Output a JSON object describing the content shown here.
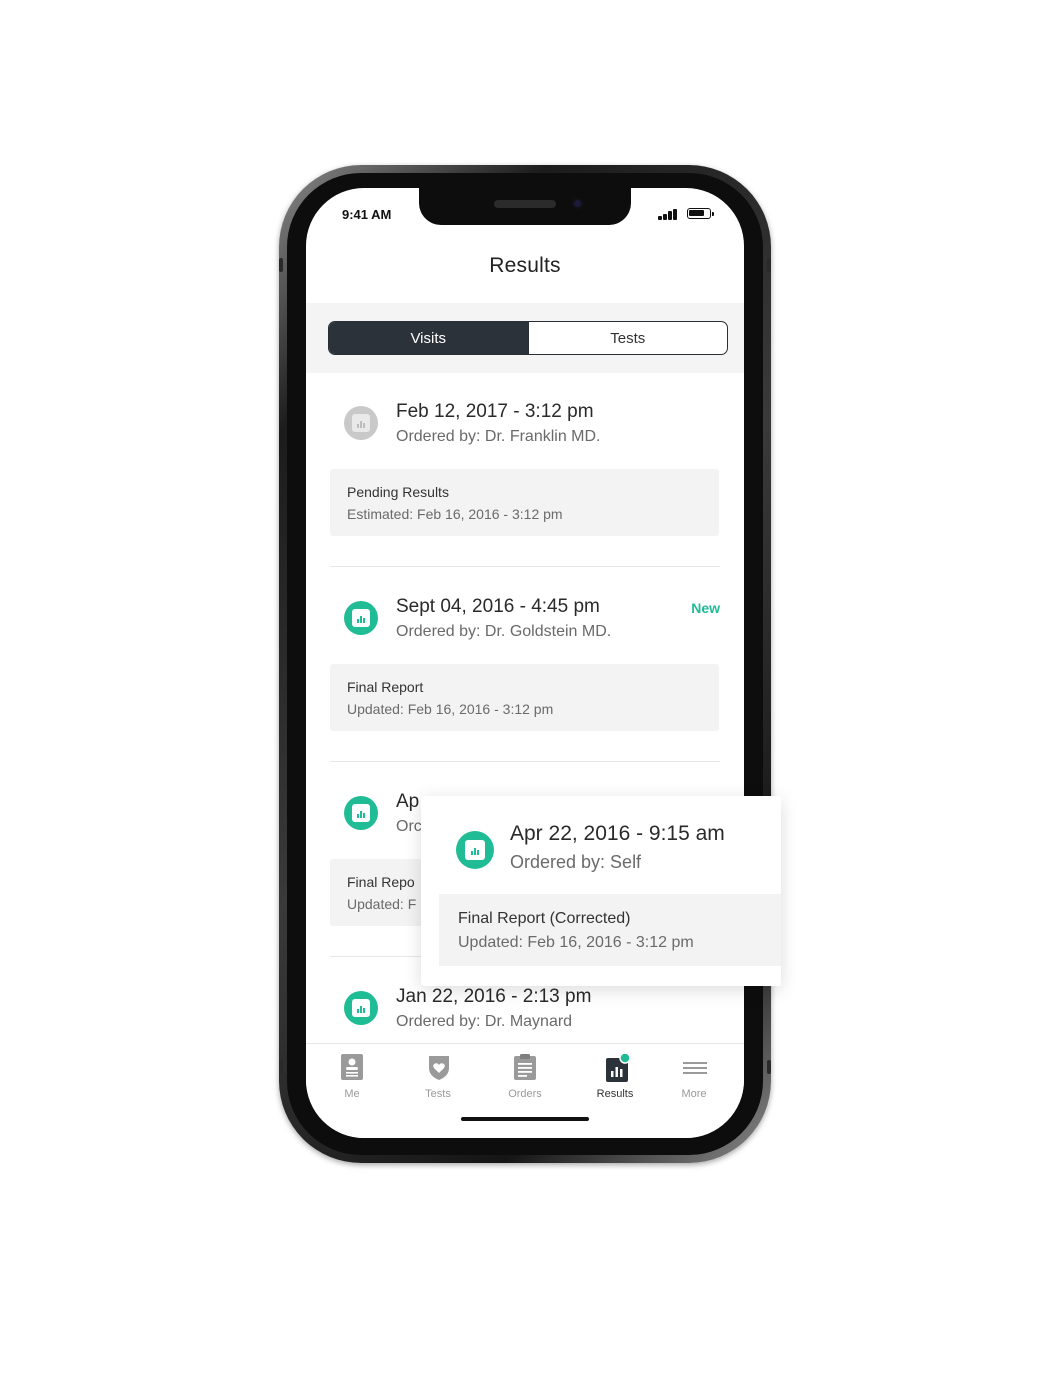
{
  "status_bar": {
    "time": "9:41 AM"
  },
  "header": {
    "title": "Results"
  },
  "segmented": {
    "options": [
      "Visits",
      "Tests"
    ],
    "selected": "Visits"
  },
  "results": [
    {
      "date": "Feb 12, 2017 - 3:12 pm",
      "ordered_by": "Ordered by: Dr. Franklin MD.",
      "badge": "",
      "status_title": "Pending Results",
      "status_detail": "Estimated: Feb 16, 2016 - 3:12 pm",
      "icon": "report-icon-gray"
    },
    {
      "date": "Sept 04, 2016 - 4:45 pm",
      "ordered_by": "Ordered by: Dr. Goldstein MD.",
      "badge": "New",
      "status_title": "Final Report",
      "status_detail": "Updated: Feb 16, 2016 - 3:12 pm",
      "icon": "report-icon-green"
    },
    {
      "date": "Ap",
      "ordered_by": "Orc",
      "badge": "",
      "status_title": "Final Repo",
      "status_detail": "Updated: F",
      "icon": "report-icon-green"
    },
    {
      "date": "Jan 22, 2016 - 2:13 pm",
      "ordered_by": "Ordered by: Dr. Maynard",
      "badge": "",
      "status_title": "",
      "status_detail": "",
      "icon": "report-icon-green"
    }
  ],
  "expanded_card": {
    "date": "Apr 22, 2016 - 9:15 am",
    "ordered_by": "Ordered by: Self",
    "status_title": "Final Report (Corrected)",
    "status_detail": "Updated: Feb 16, 2016 - 3:12 pm",
    "icon": "report-icon-green"
  },
  "tab_bar": {
    "tabs": [
      {
        "label": "Me",
        "icon": "person-card-icon"
      },
      {
        "label": "Tests",
        "icon": "heart-shield-icon"
      },
      {
        "label": "Orders",
        "icon": "clipboard-icon"
      },
      {
        "label": "Results",
        "icon": "bar-chart-document-icon"
      },
      {
        "label": "More",
        "icon": "menu-lines-icon"
      }
    ],
    "active": "Results"
  },
  "colors": {
    "accent": "#1fbc95",
    "segment_active": "#2c323a",
    "status_box": "#f3f3f3",
    "pending_icon": "#c9c9c9"
  }
}
